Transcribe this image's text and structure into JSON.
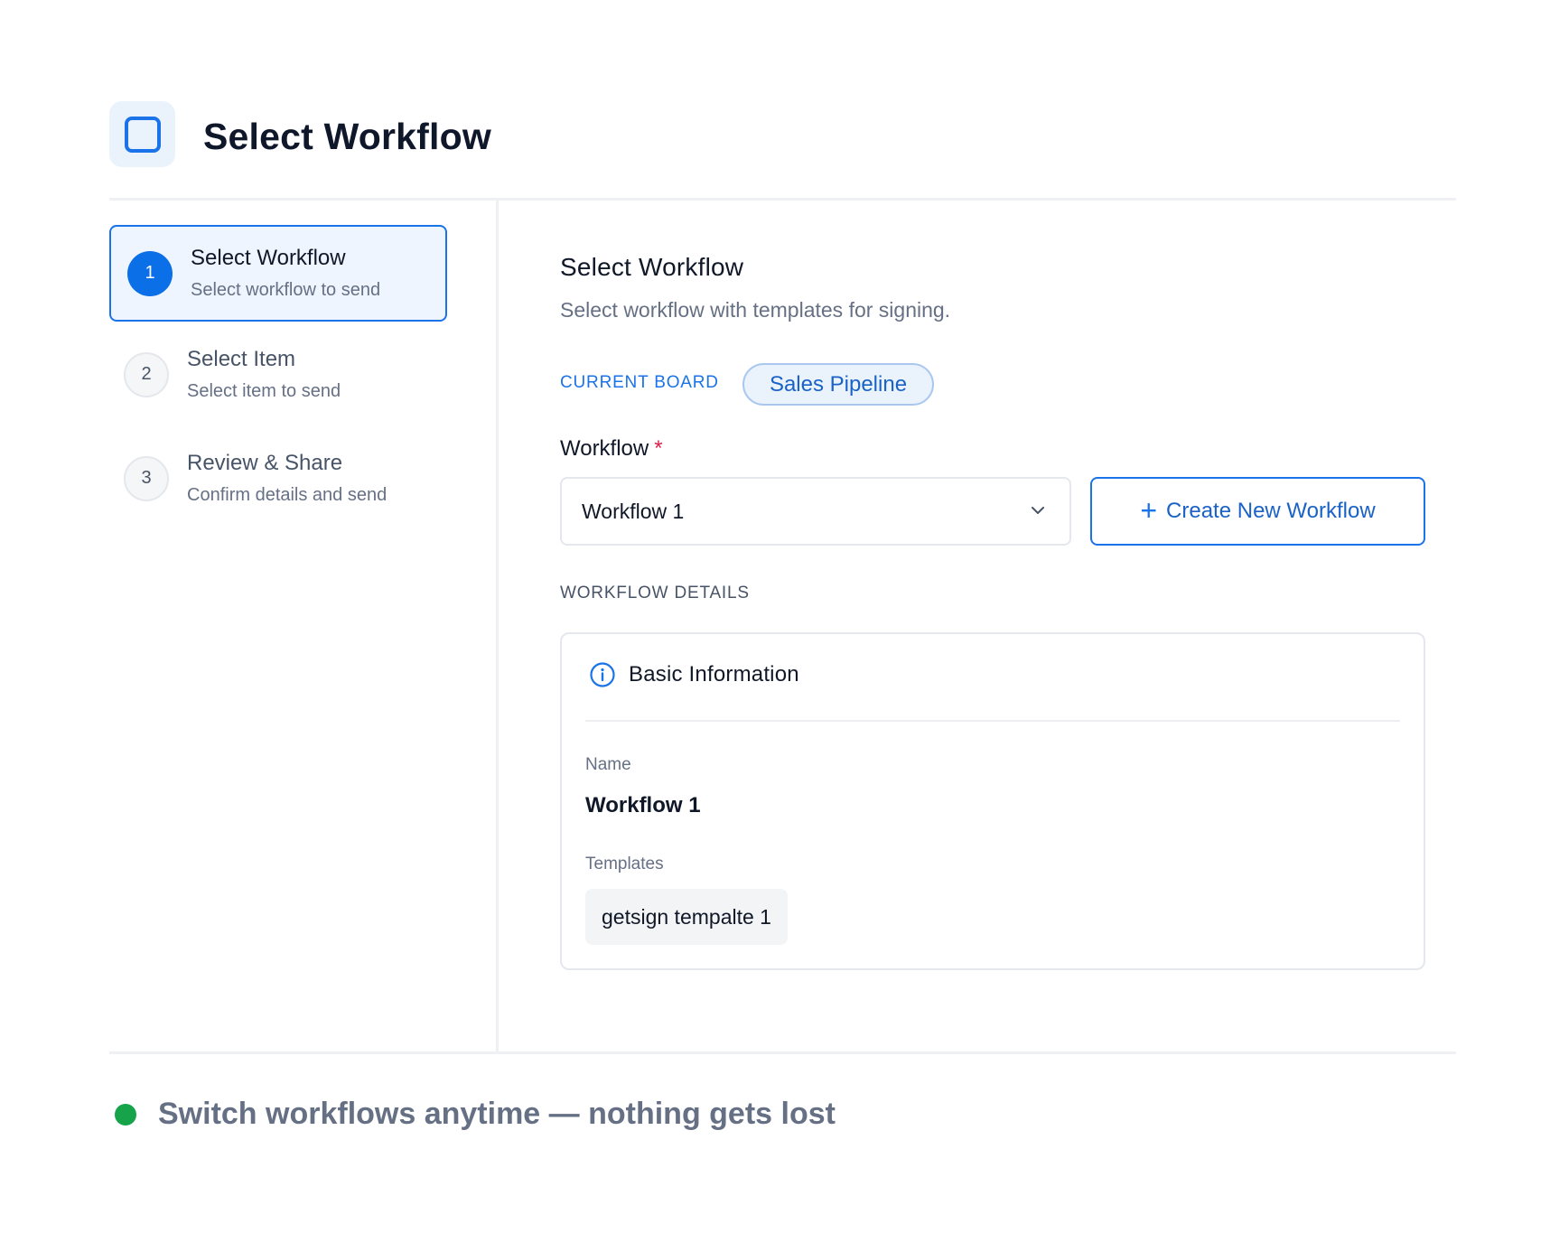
{
  "header": {
    "title": "Select Workflow",
    "icon": "square-outline-icon"
  },
  "steps": [
    {
      "number": "1",
      "title": "Select Workflow",
      "subtitle": "Select workflow to send",
      "active": true
    },
    {
      "number": "2",
      "title": "Select Item",
      "subtitle": "Select item to send",
      "active": false
    },
    {
      "number": "3",
      "title": "Review & Share",
      "subtitle": "Confirm details and send",
      "active": false
    }
  ],
  "main": {
    "title": "Select Workflow",
    "subtitle": "Select workflow with templates for signing.",
    "board_label": "CURRENT BOARD",
    "board_value": "Sales Pipeline",
    "workflow_label": "Workflow",
    "workflow_required": "*",
    "workflow_selected": "Workflow 1",
    "create_button": "Create New Workflow",
    "details_label": "WORKFLOW DETAILS",
    "card": {
      "title": "Basic Information",
      "name_label": "Name",
      "name_value": "Workflow 1",
      "templates_label": "Templates",
      "templates": [
        "getsign tempalte 1"
      ]
    }
  },
  "footer": {
    "text": "Switch workflows anytime — nothing gets lost"
  },
  "colors": {
    "accent": "#1a73e8",
    "success": "#16a34a",
    "required": "#e11d48"
  }
}
